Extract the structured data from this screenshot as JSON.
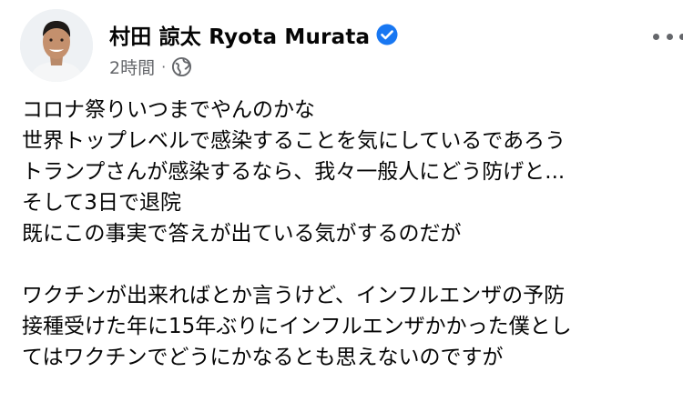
{
  "post": {
    "author": {
      "name": "村田 諒太 Ryota Murata",
      "verified": true,
      "avatar_icon": "profile-photo-icon",
      "verified_icon": "verified-badge-icon"
    },
    "meta": {
      "time": "2時間",
      "separator": "·",
      "audience_icon": "globe-icon"
    },
    "more_icon": "more-options-icon",
    "body": {
      "lines": [
        "コロナ祭りいつまでやんのかな",
        "世界トップレベルで感染することを気にしているであろう",
        "トランプさんが感染するなら、我々一般人にどう防げと...",
        "そして3日で退院",
        "既にこの事実で答えが出ている気がするのだが",
        "",
        "ワクチンが出来ればとか言うけど、インフルエンザの予防",
        "接種受けた年に15年ぶりにインフルエンザかかった僕とし",
        "てはワクチンでどうにかなるとも思えないのですが"
      ]
    },
    "colors": {
      "text": "#050505",
      "secondary": "#65676b",
      "verified": "#1877f2"
    }
  }
}
